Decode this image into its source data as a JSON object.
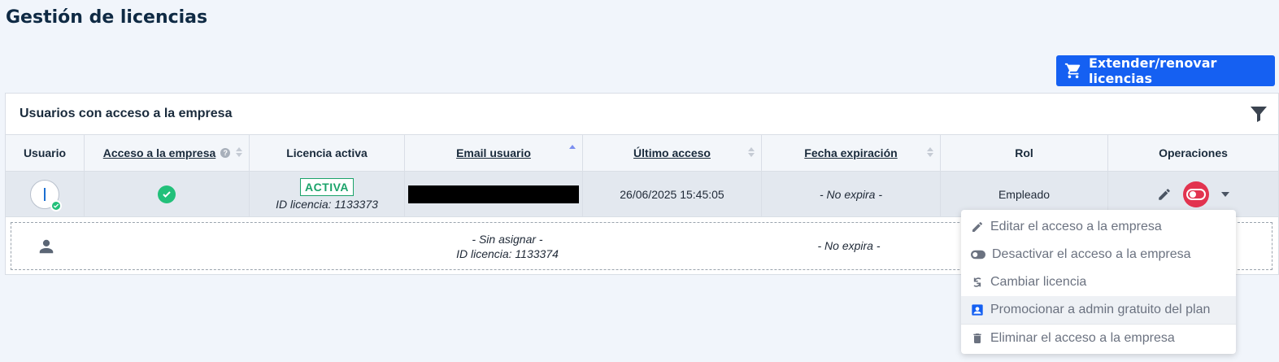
{
  "page": {
    "title": "Gestión de licencias"
  },
  "toolbar": {
    "extend_label": "Extender/renovar licencias",
    "extend_icon": "cart-icon"
  },
  "panel": {
    "title": "Usuarios con acceso a la empresa",
    "filter_icon": "filter-icon"
  },
  "table": {
    "columns": [
      {
        "label": "Usuario"
      },
      {
        "label": "Acceso a la empresa"
      },
      {
        "label": "Licencia activa"
      },
      {
        "label": "Email usuario"
      },
      {
        "label": "Último acceso"
      },
      {
        "label": "Fecha expiración"
      },
      {
        "label": "Rol"
      },
      {
        "label": "Operaciones"
      }
    ],
    "help_glyph": "?",
    "rows": [
      {
        "status_badge": "ACTIVA",
        "license_id": "ID licencia: 1133373",
        "email": "",
        "last_access": "26/06/2025 15:45:05",
        "expiration": "- No expira -",
        "role": "Empleado"
      }
    ],
    "unassigned": {
      "status": "- Sin asignar -",
      "license_id": "ID licencia: 1133374",
      "expiration": "- No expira -"
    }
  },
  "menu": {
    "items": [
      {
        "label": "Editar el acceso a la empresa",
        "icon": "pencil-icon"
      },
      {
        "label": "Desactivar el acceso a la empresa",
        "icon": "toggle-icon"
      },
      {
        "label": "Cambiar licencia",
        "icon": "swap-icon"
      },
      {
        "label": "Promocionar a admin gratuito del plan",
        "icon": "admin-badge-icon"
      },
      {
        "label": "Eliminar el acceso a la empresa",
        "icon": "trash-icon"
      }
    ]
  },
  "colors": {
    "primary": "#1560f2",
    "success": "#22c07a",
    "danger": "#e2334f",
    "background": "#f1f5fb"
  }
}
